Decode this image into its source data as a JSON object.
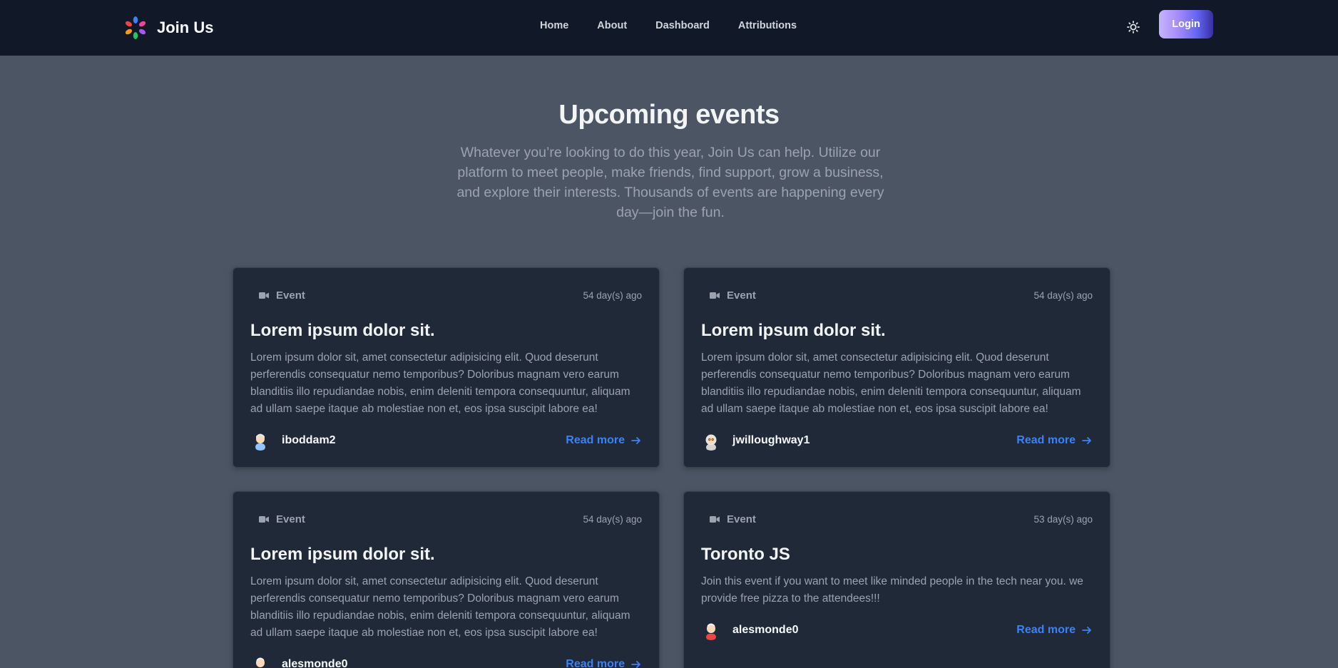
{
  "brand": {
    "name": "Join Us",
    "logo_icon": "flower-logo-icon"
  },
  "nav": {
    "links": [
      {
        "label": "Home"
      },
      {
        "label": "About"
      },
      {
        "label": "Dashboard"
      },
      {
        "label": "Attributions"
      }
    ],
    "theme_toggle_icon": "sun-icon",
    "login_label": "Login"
  },
  "hero": {
    "title": "Upcoming events",
    "text": "Whatever you’re looking to do this year, Join Us can help. Utilize our platform to meet people, make friends, find support, grow a business, and explore their interests. Thousands of events are happening every day—join the fun."
  },
  "events": [
    {
      "type": "Event",
      "time": "54 day(s) ago",
      "title": "Lorem ipsum dolor sit.",
      "description": "Lorem ipsum dolor sit, amet consectetur adipisicing elit. Quod deserunt perferendis consequatur nemo temporibus? Doloribus magnam vero earum blanditiis illo repudiandae nobis, enim deleniti tempora consequuntur, aliquam ad ullam saepe itaque ab molestiae non et, eos ipsa suscipit labore ea!",
      "author": "iboddam2",
      "read_more": "Read more"
    },
    {
      "type": "Event",
      "time": "54 day(s) ago",
      "title": "Lorem ipsum dolor sit.",
      "description": "Lorem ipsum dolor sit, amet consectetur adipisicing elit. Quod deserunt perferendis consequatur nemo temporibus? Doloribus magnam vero earum blanditiis illo repudiandae nobis, enim deleniti tempora consequuntur, aliquam ad ullam saepe itaque ab molestiae non et, eos ipsa suscipit labore ea!",
      "author": "jwilloughway1",
      "read_more": "Read more"
    },
    {
      "type": "Event",
      "time": "54 day(s) ago",
      "title": "Lorem ipsum dolor sit.",
      "description": "Lorem ipsum dolor sit, amet consectetur adipisicing elit. Quod deserunt perferendis consequatur nemo temporibus? Doloribus magnam vero earum blanditiis illo repudiandae nobis, enim deleniti tempora consequuntur, aliquam ad ullam saepe itaque ab molestiae non et, eos ipsa suscipit labore ea!",
      "author": "alesmonde0",
      "read_more": "Read more"
    },
    {
      "type": "Event",
      "time": "53 day(s) ago",
      "title": "Toronto JS",
      "description": "Join this event if you want to meet like minded people in the tech near you. we provide free pizza to the attendees!!!",
      "author": "alesmonde0",
      "read_more": "Read more"
    }
  ]
}
